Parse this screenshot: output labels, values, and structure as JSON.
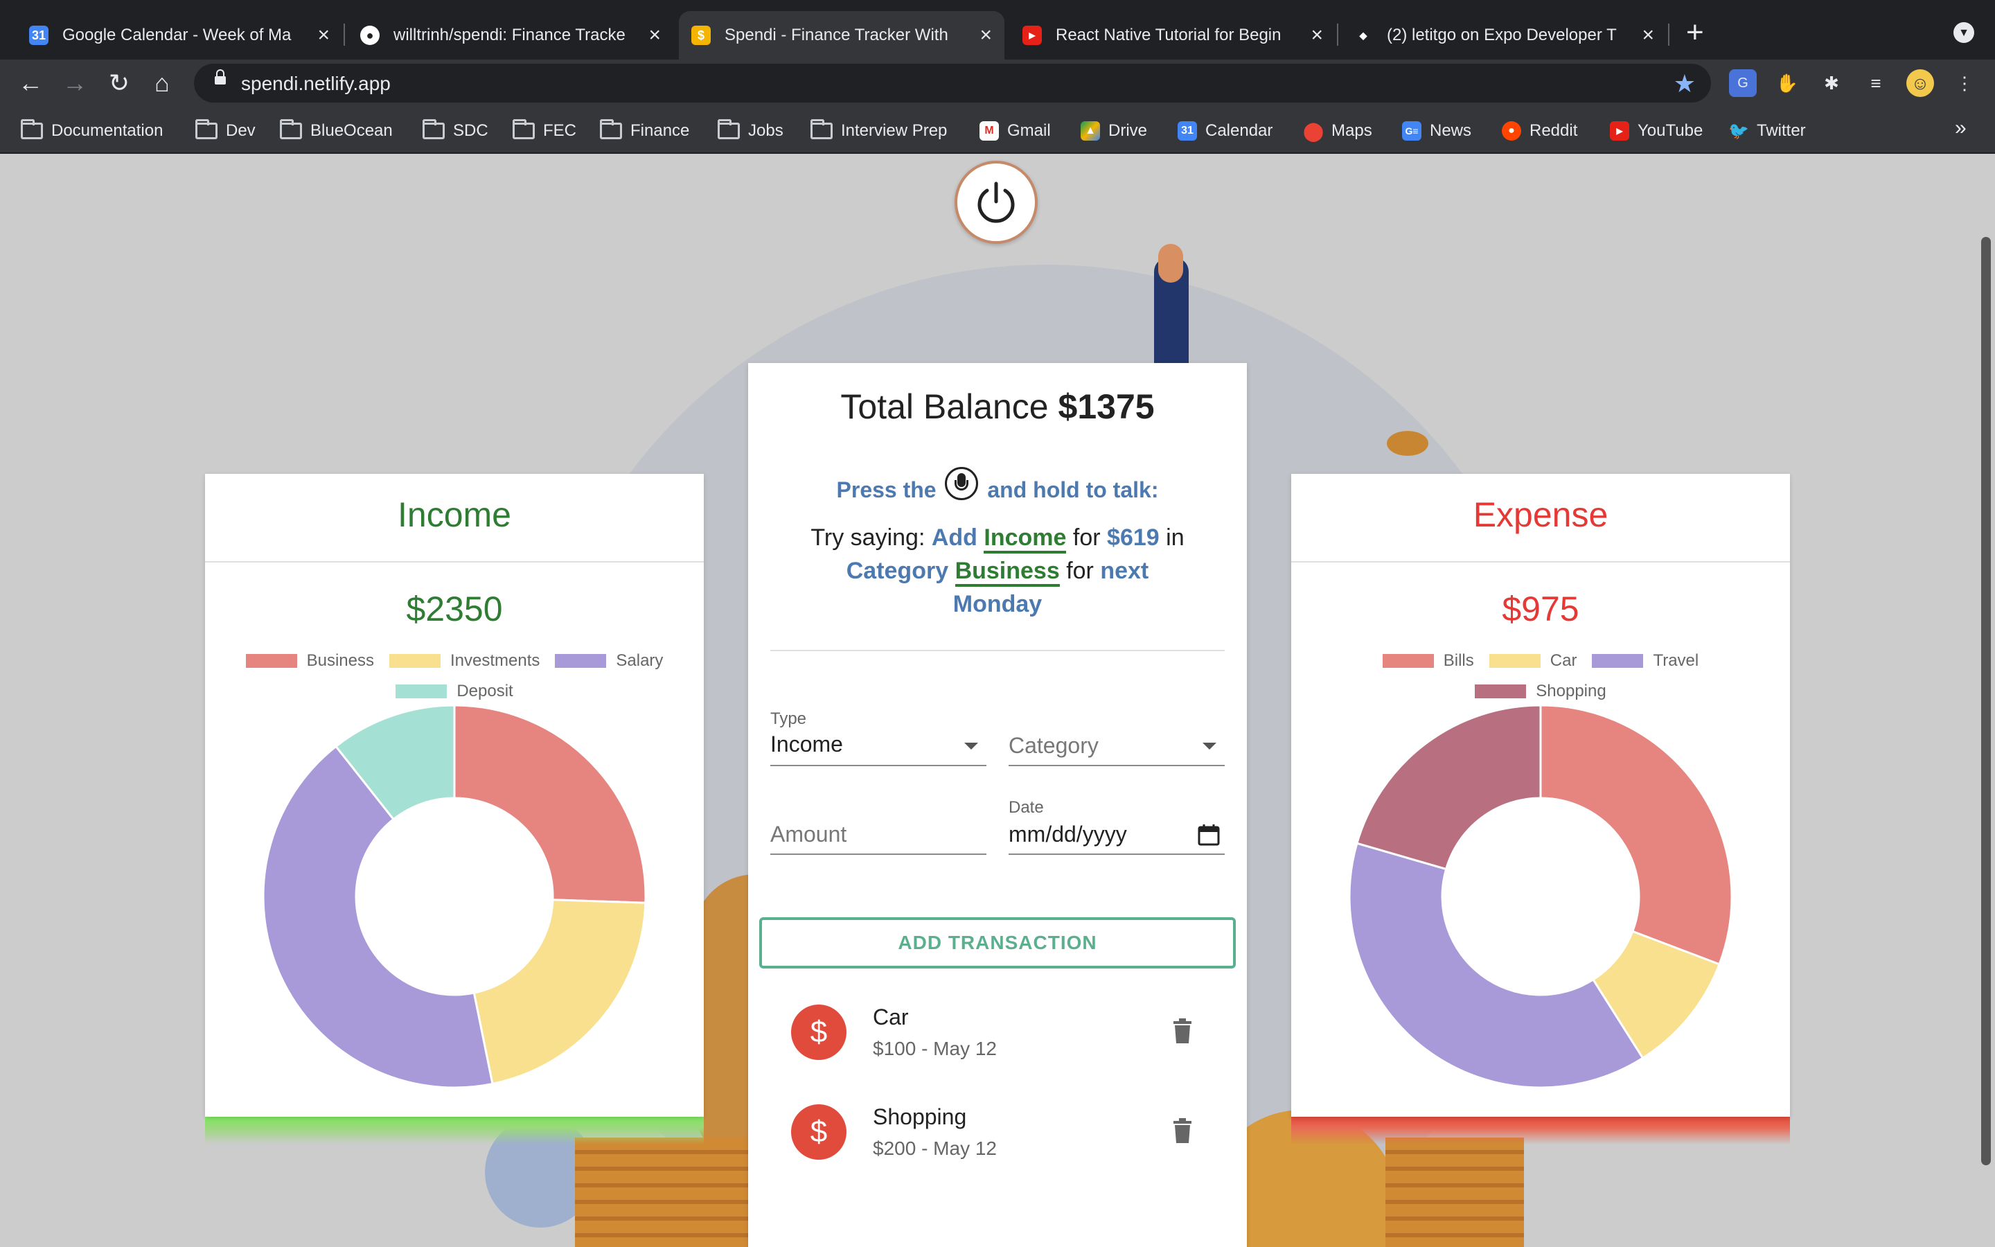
{
  "browser": {
    "tabs": [
      {
        "title": "Google Calendar - Week of Ma",
        "icon": "calendar-icon",
        "active": false
      },
      {
        "title": "willtrinh/spendi: Finance Tracke",
        "icon": "github-icon",
        "active": false
      },
      {
        "title": "Spendi - Finance Tracker With",
        "icon": "spendi-icon",
        "active": true
      },
      {
        "title": "React Native Tutorial for Begin",
        "icon": "youtube-icon",
        "active": false
      },
      {
        "title": "(2) letitgo on Expo Developer T",
        "icon": "expo-icon",
        "active": false
      }
    ],
    "url": "spendi.netlify.app",
    "bookmarks": [
      {
        "label": "Documentation",
        "icon": "folder-icon"
      },
      {
        "label": "Dev",
        "icon": "folder-icon"
      },
      {
        "label": "BlueOcean",
        "icon": "folder-icon"
      },
      {
        "label": "SDC",
        "icon": "folder-icon"
      },
      {
        "label": "FEC",
        "icon": "folder-icon"
      },
      {
        "label": "Finance",
        "icon": "folder-icon"
      },
      {
        "label": "Jobs",
        "icon": "folder-icon"
      },
      {
        "label": "Interview Prep",
        "icon": "folder-icon"
      },
      {
        "label": "Gmail",
        "icon": "gmail-icon"
      },
      {
        "label": "Drive",
        "icon": "drive-icon"
      },
      {
        "label": "Calendar",
        "icon": "calendar-icon"
      },
      {
        "label": "Maps",
        "icon": "maps-icon"
      },
      {
        "label": "News",
        "icon": "news-icon"
      },
      {
        "label": "Reddit",
        "icon": "reddit-icon"
      },
      {
        "label": "YouTube",
        "icon": "youtube-icon"
      },
      {
        "label": "Twitter",
        "icon": "twitter-icon"
      }
    ]
  },
  "income": {
    "title": "Income",
    "total": "$2350",
    "color": "#2e7d32",
    "legend": [
      "Business",
      "Investments",
      "Salary",
      "Deposit"
    ]
  },
  "expense": {
    "title": "Expense",
    "total": "$975",
    "color": "#e53935",
    "legend": [
      "Bills",
      "Car",
      "Travel",
      "Shopping"
    ]
  },
  "main": {
    "balance_label": "Total Balance",
    "balance_value": "$1375",
    "press_before": "Press the",
    "press_after": "and hold to talk:",
    "try": {
      "prefix": "Try saying:",
      "add": "Add",
      "type": "Income",
      "for1": "for",
      "amount": "$619",
      "in": "in",
      "category_word": "Category",
      "category": "Business",
      "for2": "for",
      "next": "next",
      "day": "Monday"
    },
    "form": {
      "type_label": "Type",
      "type_value": "Income",
      "category_placeholder": "Category",
      "amount_placeholder": "Amount",
      "date_label": "Date",
      "date_placeholder": "mm/dd/yyyy",
      "add_button": "ADD TRANSACTION"
    },
    "transactions": [
      {
        "name": "Car",
        "detail": "$100 - May 12"
      },
      {
        "name": "Shopping",
        "detail": "$200 - May 12"
      }
    ]
  },
  "chart_data": [
    {
      "type": "pie",
      "title": "Income",
      "categories": [
        "Business",
        "Investments",
        "Salary",
        "Deposit"
      ],
      "values": [
        600,
        500,
        1000,
        250
      ],
      "colors": [
        "#e6857f",
        "#f8e08e",
        "#a899d9",
        "#a4e0d4"
      ],
      "donut": true
    },
    {
      "type": "pie",
      "title": "Expense",
      "categories": [
        "Bills",
        "Car",
        "Travel",
        "Shopping"
      ],
      "values": [
        300,
        100,
        375,
        200
      ],
      "colors": [
        "#e6857f",
        "#f8e08e",
        "#a899d9",
        "#b87080"
      ],
      "donut": true
    }
  ]
}
